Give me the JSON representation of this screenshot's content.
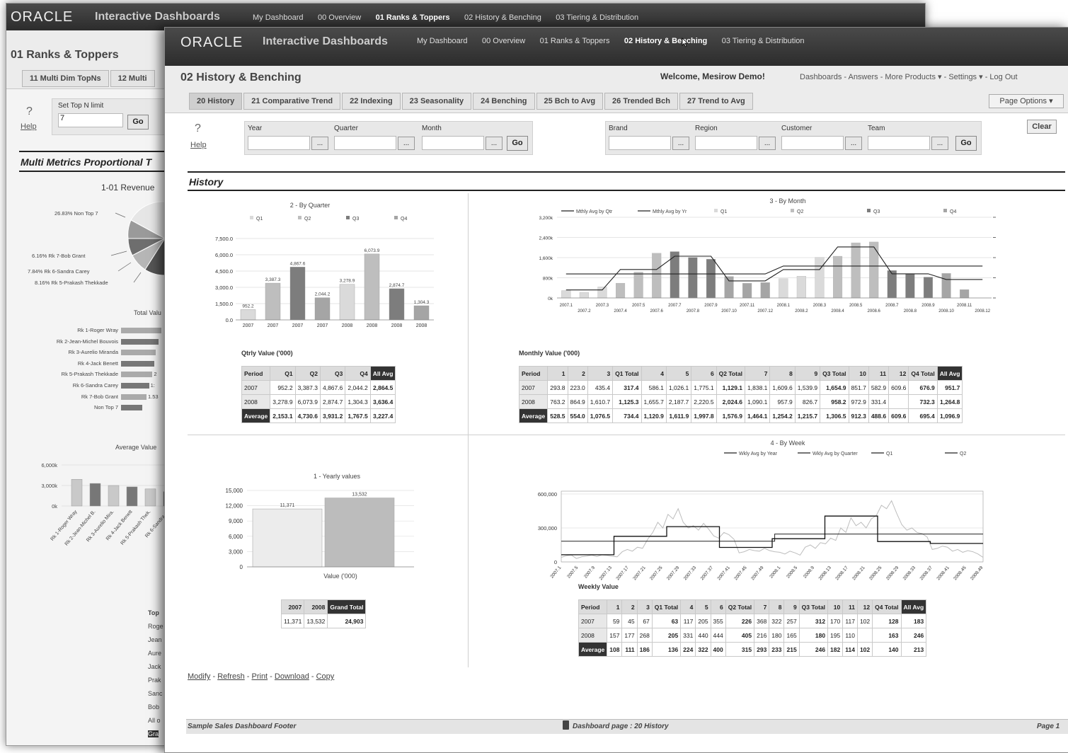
{
  "back_window": {
    "logo": "ORACLE",
    "app_title": "Interactive Dashboards",
    "nav": [
      "My Dashboard",
      "00 Overview",
      "01 Ranks & Toppers",
      "02 History & Benching",
      "03 Tiering & Distribution"
    ],
    "page_title": "01 Ranks & Toppers",
    "tabs": [
      "11 Multi Dim TopNs",
      "12 Multi"
    ],
    "prompt_label": "Set Top N limit",
    "prompt_value": "7",
    "go": "Go",
    "help_q": "?",
    "help": "Help",
    "section_title": "Multi Metrics Proportional T",
    "revenue_label": "1-01  Revenue",
    "pie_labels": [
      "26.83%  Non Top 7",
      "6.16%  Rk 7-Bob Grant",
      "7.84%  Rk 6-Sandra Carey",
      "8.16%  Rk 5-Prakash Thekkade"
    ],
    "total_label": "Total Valu",
    "rank_names": [
      "Rk 1-Roger Wray",
      "Rk 2-Jean-Michel Bouvois",
      "Rk 3-Aurelio Miranda",
      "Rk 4-Jack Benett",
      "Rk 5-Prakash Thekkade",
      "Rk 6-Sandra Carey",
      "Rk 7-Bob Grant",
      "Non Top 7"
    ],
    "rank_values": [
      0.95,
      0.88,
      0.82,
      0.78,
      0.74,
      0.66,
      0.6,
      0.5
    ],
    "rank_tail": [
      "",
      "",
      "",
      "",
      "2",
      "1:",
      "1.53",
      ""
    ],
    "avg_label": "Average Value",
    "avg_yticks": [
      "6,000k",
      "3,000k",
      "0k"
    ],
    "avg_cats": [
      "Rk 1-Roger Wray",
      "Rk 2-Jean-Michel B.",
      "Rk 3-Aurelio Mira.",
      "Rk 4-Jack Benett",
      "Rk 5-Prakash Thek.",
      "Rk 6-Sandra C."
    ],
    "avg_values": [
      3900,
      3300,
      3000,
      2800,
      2500,
      2100
    ],
    "right_list": [
      "Top",
      "Roge",
      "Jean",
      "Aure",
      "Jack",
      "Prak",
      "Sanc",
      "Bob",
      "All o",
      "Gra"
    ]
  },
  "front_window": {
    "logo": "ORACLE",
    "app_title": "Interactive Dashboards",
    "nav": [
      "My Dashboard",
      "00 Overview",
      "01 Ranks & Toppers",
      "02 History & Benching",
      "03 Tiering & Distribution"
    ],
    "active_nav": "02 History & Benching",
    "page_title": "02 History & Benching",
    "welcome": "Welcome, Mesirow Demo!",
    "util_links": "Dashboards - Answers - More Products ▾ - Settings ▾ - Log Out",
    "tabs": [
      "20 History",
      "21 Comparative Trend",
      "22 Indexing",
      "23 Seasonality",
      "24 Benching",
      "25 Bch to Avg",
      "26 Trended Bch",
      "27 Trend to Avg"
    ],
    "page_options": "Page Options ▾",
    "help_q": "?",
    "help": "Help",
    "prompts_left": [
      "Year",
      "Quarter",
      "Month"
    ],
    "prompts_right": [
      "Brand",
      "Region",
      "Customer",
      "Team"
    ],
    "ellipsis": "...",
    "go": "Go",
    "clear": "Clear",
    "section_title": "History",
    "links": [
      "Modify",
      "Refresh",
      "Print",
      "Download",
      "Copy"
    ],
    "footer_left": "Sample Sales Dashboard Footer",
    "footer_mid": "Dashboard page : 20 History",
    "footer_right": "Page 1"
  },
  "chart_data": [
    {
      "type": "bar",
      "title": "2 - By Quarter",
      "legend": [
        "Q1",
        "Q2",
        "Q3",
        "Q4"
      ],
      "categories": [
        "2007 Q1",
        "2007 Q2",
        "2007 Q3",
        "2007 Q4",
        "2008 Q1",
        "2008 Q2",
        "2008 Q3",
        "2008 Q4"
      ],
      "values": [
        952.2,
        3387.3,
        4867.6,
        2044.2,
        3278.9,
        6073.9,
        2874.7,
        1304.3
      ],
      "value_labels": [
        "952.2",
        "3,387.3",
        "4,867.6",
        "2,044.2",
        "3,278.9",
        "6,073.9",
        "2,874.7",
        "1,304.3"
      ],
      "yticks": [
        "0.0",
        "1,500.0",
        "3,000.0",
        "4,500.0",
        "6,000.0",
        "7,500.0"
      ],
      "ylim": [
        0,
        7500
      ],
      "colors": [
        "#dadada",
        "#bebebe",
        "#7d7d7d",
        "#a5a5a5"
      ]
    },
    {
      "type": "bar",
      "title": "3 - By Month",
      "legend": [
        "Mthly Avg by Qtr",
        "Mthly Avg by Yr",
        "Q1",
        "Q2",
        "Q3",
        "Q4"
      ],
      "x": [
        "2007.1",
        "2007.2",
        "2007.3",
        "2007.4",
        "2007.5",
        "2007.6",
        "2007.7",
        "2007.8",
        "2007.9",
        "2007.10",
        "2007.11",
        "2007.12",
        "2008.1",
        "2008.2",
        "2008.3",
        "2008.4",
        "2008.5",
        "2008.6",
        "2008.7",
        "2008.8",
        "2008.9",
        "2008.10",
        "2008.11",
        "2008.12"
      ],
      "values": [
        293.8,
        223.0,
        435.4,
        586.1,
        1026.1,
        1775.1,
        1838.1,
        1609.6,
        1539.9,
        851.7,
        582.9,
        609.6,
        763.2,
        864.9,
        1610.7,
        1655.7,
        2187.7,
        2220.5,
        1090.1,
        957.9,
        826.7,
        972.9,
        331.4,
        0
      ],
      "avg_by_qtr": [
        317.4,
        317.4,
        317.4,
        1129.1,
        1129.1,
        1129.1,
        1654.9,
        1654.9,
        1654.9,
        676.9,
        676.9,
        676.9,
        1125.3,
        1125.3,
        1125.3,
        2024.6,
        2024.6,
        2024.6,
        958.2,
        958.2,
        958.2,
        732.3,
        732.3,
        732.3
      ],
      "avg_by_yr": [
        951.7,
        951.7,
        951.7,
        951.7,
        951.7,
        951.7,
        951.7,
        951.7,
        951.7,
        951.7,
        951.7,
        951.7,
        1264.8,
        1264.8,
        1264.8,
        1264.8,
        1264.8,
        1264.8,
        1264.8,
        1264.8,
        1264.8,
        1264.8,
        1264.8,
        1264.8
      ],
      "yticks": [
        "0k",
        "800k",
        "1,600k",
        "2,400k",
        "3,200k"
      ],
      "ylim": [
        0,
        3200
      ],
      "colors": [
        "#dadada",
        "#bebebe",
        "#7d7d7d",
        "#a5a5a5"
      ]
    },
    {
      "type": "bar",
      "title": "1 - Yearly values",
      "categories": [
        "2007",
        "2008"
      ],
      "values": [
        11371,
        13532
      ],
      "value_labels": [
        "11,371",
        "13,532"
      ],
      "xlabel": "Value ('000)",
      "yticks": [
        "0",
        "3,000",
        "6,000",
        "9,000",
        "12,000",
        "15,000"
      ],
      "ylim": [
        0,
        15000
      ],
      "colors": [
        "#ececec",
        "#bcbcbc"
      ]
    },
    {
      "type": "line",
      "title": "4 - By Week",
      "legend": [
        "Wkly Avg by Year",
        "Wkly Avg by Quarter",
        "Q1",
        "Q2",
        "Q3",
        "Q4"
      ],
      "yticks": [
        "0",
        "300,000",
        "600,000"
      ],
      "ylim": [
        0,
        600000
      ],
      "x_labels": [
        "2007.1",
        "2007.5",
        "2007.9",
        "2007.13",
        "2007.17",
        "2007.21",
        "2007.25",
        "2007.29",
        "2007.33",
        "2007.37",
        "2007.41",
        "2007.45",
        "2007.49",
        "2008.1",
        "2008.5",
        "2008.9",
        "2008.13",
        "2008.17",
        "2008.21",
        "2008.25",
        "2008.29",
        "2008.33",
        "2008.37",
        "2008.41",
        "2008.45",
        "2008.49"
      ],
      "weekly": [
        40,
        55,
        60,
        30,
        45,
        52,
        60,
        48,
        62,
        58,
        50,
        45,
        90,
        110,
        95,
        130,
        120,
        200,
        260,
        350,
        300,
        420,
        380,
        470,
        350,
        300,
        320,
        280,
        340,
        290,
        230,
        210,
        260,
        240,
        200,
        80,
        90,
        110,
        100,
        95,
        120,
        100,
        90,
        85,
        70,
        95,
        80,
        60,
        130,
        150,
        120,
        170,
        160,
        210,
        190,
        300,
        260,
        390,
        320,
        350,
        300,
        380,
        410,
        500,
        470,
        540,
        430,
        330,
        280,
        300,
        260,
        250,
        220,
        110,
        120,
        140,
        130,
        95,
        110,
        85,
        100,
        90,
        70,
        40
      ],
      "avg_by_year": [
        183,
        246
      ],
      "avg_by_quarter": [
        63,
        226,
        312,
        128,
        205,
        405,
        180,
        163
      ]
    }
  ],
  "tables": {
    "qtrly": {
      "caption": "Qtrly Value ('000)",
      "headers": [
        "Period",
        "Q1",
        "Q2",
        "Q3",
        "Q4",
        "All Avg"
      ],
      "rows": [
        [
          "2007",
          "952.2",
          "3,387.3",
          "4,867.6",
          "2,044.2",
          "2,864.5"
        ],
        [
          "2008",
          "3,278.9",
          "6,073.9",
          "2,874.7",
          "1,304.3",
          "3,636.4"
        ],
        [
          "Average",
          "2,153.1",
          "4,730.6",
          "3,931.2",
          "1,767.5",
          "3,227.4"
        ]
      ]
    },
    "monthly": {
      "caption": "Monthly Value ('000)",
      "headers": [
        "Period",
        "1",
        "2",
        "3",
        "Q1 Total",
        "4",
        "5",
        "6",
        "Q2 Total",
        "7",
        "8",
        "9",
        "Q3 Total",
        "10",
        "11",
        "12",
        "Q4 Total",
        "All Avg"
      ],
      "rows": [
        [
          "2007",
          "293.8",
          "223.0",
          "435.4",
          "317.4",
          "586.1",
          "1,026.1",
          "1,775.1",
          "1,129.1",
          "1,838.1",
          "1,609.6",
          "1,539.9",
          "1,654.9",
          "851.7",
          "582.9",
          "609.6",
          "676.9",
          "951.7"
        ],
        [
          "2008",
          "763.2",
          "864.9",
          "1,610.7",
          "1,125.3",
          "1,655.7",
          "2,187.7",
          "2,220.5",
          "2,024.6",
          "1,090.1",
          "957.9",
          "826.7",
          "958.2",
          "972.9",
          "331.4",
          "",
          "732.3",
          "1,264.8"
        ],
        [
          "Average",
          "528.5",
          "554.0",
          "1,076.5",
          "734.4",
          "1,120.9",
          "1,611.9",
          "1,997.8",
          "1,576.9",
          "1,464.1",
          "1,254.2",
          "1,215.7",
          "1,306.5",
          "912.3",
          "488.6",
          "609.6",
          "695.4",
          "1,096.9"
        ]
      ]
    },
    "yearly": {
      "headers": [
        "2007",
        "2008",
        "Grand Total"
      ],
      "row": [
        "11,371",
        "13,532",
        "24,903"
      ]
    },
    "weekly": {
      "caption": "Weekly Value",
      "headers": [
        "Period",
        "1",
        "2",
        "3",
        "Q1 Total",
        "4",
        "5",
        "6",
        "Q2 Total",
        "7",
        "8",
        "9",
        "Q3 Total",
        "10",
        "11",
        "12",
        "Q4 Total",
        "All Avg"
      ],
      "rows": [
        [
          "2007",
          "59",
          "45",
          "67",
          "63",
          "117",
          "205",
          "355",
          "226",
          "368",
          "322",
          "257",
          "312",
          "170",
          "117",
          "102",
          "128",
          "183"
        ],
        [
          "2008",
          "157",
          "177",
          "268",
          "205",
          "331",
          "440",
          "444",
          "405",
          "216",
          "180",
          "165",
          "180",
          "195",
          "110",
          "",
          "163",
          "246"
        ],
        [
          "Average",
          "108",
          "111",
          "186",
          "136",
          "224",
          "322",
          "400",
          "315",
          "293",
          "233",
          "215",
          "246",
          "182",
          "114",
          "102",
          "140",
          "213"
        ]
      ]
    }
  },
  "colors": {
    "header": "#333333",
    "accent_dark": "#333333"
  }
}
